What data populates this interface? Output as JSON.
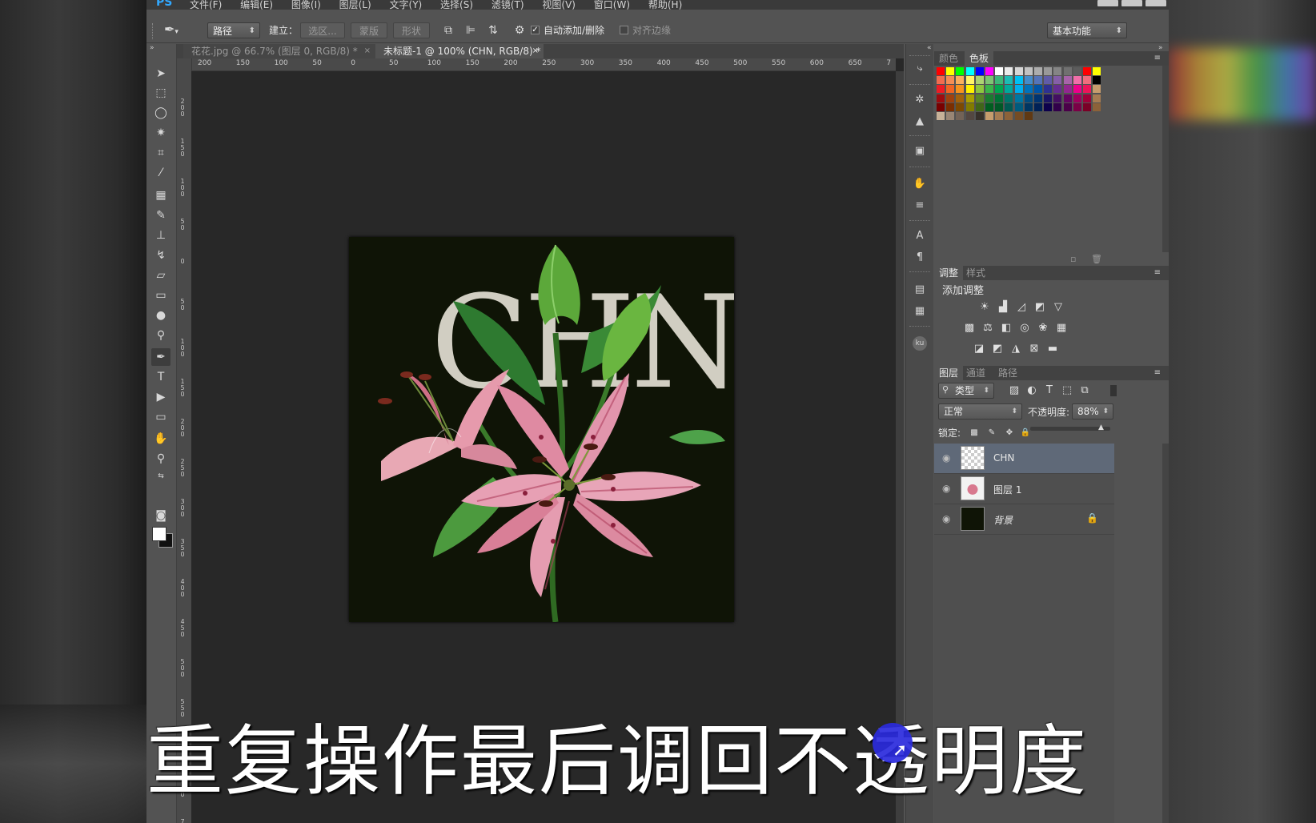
{
  "menubar": {
    "logo": "PS",
    "items": [
      "文件(F)",
      "编辑(E)",
      "图像(I)",
      "图层(L)",
      "文字(Y)",
      "选择(S)",
      "滤镜(T)",
      "视图(V)",
      "窗口(W)",
      "帮助(H)"
    ]
  },
  "options": {
    "mode_select": "路径",
    "build_label": "建立：",
    "btn_selection": "选区...",
    "btn_mask": "蒙版",
    "btn_shape": "形状",
    "auto_add_delete": "自动添加/删除",
    "auto_add_checked": "✓",
    "align_edges": "对齐边缘",
    "workspace": "基本功能"
  },
  "tabs": [
    {
      "label": "花花.jpg @ 66.7% (图层 0, RGB/8) *",
      "close": "×"
    },
    {
      "label": "未标题-1 @ 100% (CHN, RGB/8) *",
      "close": "×"
    }
  ],
  "ruler": {
    "h": [
      "200",
      "150",
      "100",
      "50",
      "0",
      "50",
      "100",
      "150",
      "200",
      "250",
      "300",
      "350",
      "400",
      "450",
      "500",
      "550",
      "600",
      "650",
      "7"
    ],
    "v": [
      "2 0 0",
      "1 5 0",
      "1 0 0",
      "5 0",
      "0",
      "5 0",
      "1 0 0",
      "1 5 0",
      "2 0 0",
      "2 5 0",
      "3 0 0",
      "3 5 0",
      "4 0 0",
      "4 5 0",
      "5 0 0",
      "5 5 0",
      "6 0 0",
      "6 5 0",
      "7"
    ]
  },
  "artwork": {
    "text": "CHN",
    "bg_color": "#0f1406"
  },
  "swatch_panel": {
    "tab_color": "颜色",
    "tab_swatches": "色板"
  },
  "adjust_panel": {
    "tab_adjust": "调整",
    "tab_styles": "样式",
    "title": "添加调整"
  },
  "layers_panel": {
    "tab_layers": "图层",
    "tab_channels": "通道",
    "tab_paths": "路径",
    "filter_kind": "类型",
    "blend_mode": "正常",
    "opacity_label": "不透明度:",
    "opacity_value": "88%",
    "lock_label": "锁定:",
    "layers": [
      {
        "name": "CHN",
        "selected": true
      },
      {
        "name": "图层 1",
        "selected": false
      },
      {
        "name": "背景",
        "selected": false,
        "locked": true
      }
    ]
  },
  "subtitle": "重复操作最后调回不透明度"
}
